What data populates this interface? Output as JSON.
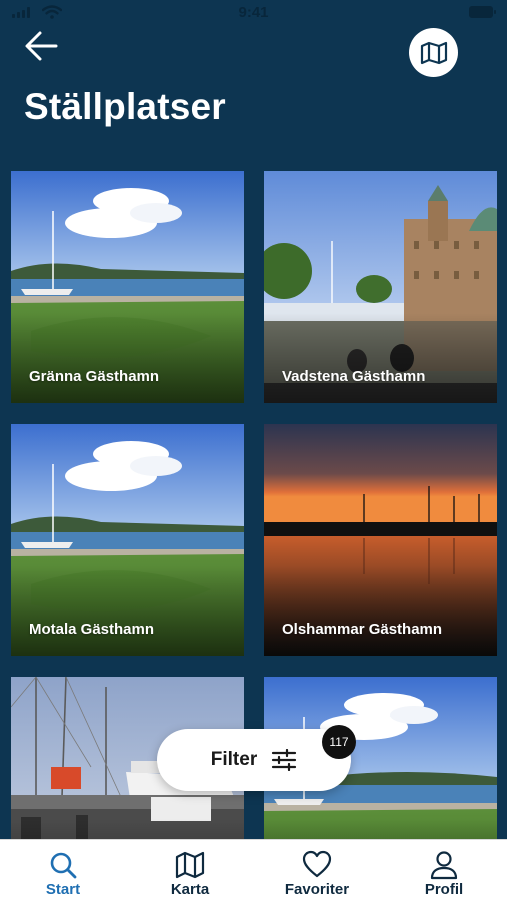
{
  "status_bar": {
    "time": "9:41"
  },
  "header": {
    "title": "Ställplatser",
    "back_icon": "arrow-left-icon",
    "map_icon": "map-icon"
  },
  "places": [
    {
      "name": "Gränna Gästhamn"
    },
    {
      "name": "Vadstena Gästhamn"
    },
    {
      "name": "Motala Gästhamn"
    },
    {
      "name": "Olshammar Gästhamn"
    },
    {
      "name": ""
    },
    {
      "name": ""
    }
  ],
  "filter": {
    "label": "Filter",
    "count": "117",
    "icon": "sliders-icon"
  },
  "tabs": [
    {
      "label": "Start",
      "icon": "search-icon",
      "active": true
    },
    {
      "label": "Karta",
      "icon": "map-icon",
      "active": false
    },
    {
      "label": "Favoriter",
      "icon": "heart-icon",
      "active": false
    },
    {
      "label": "Profil",
      "icon": "user-icon",
      "active": false
    }
  ],
  "colors": {
    "background": "#0d3551",
    "tab_active": "#1f6fb2",
    "tab_inactive": "#0f2a3f",
    "badge": "#111111"
  }
}
